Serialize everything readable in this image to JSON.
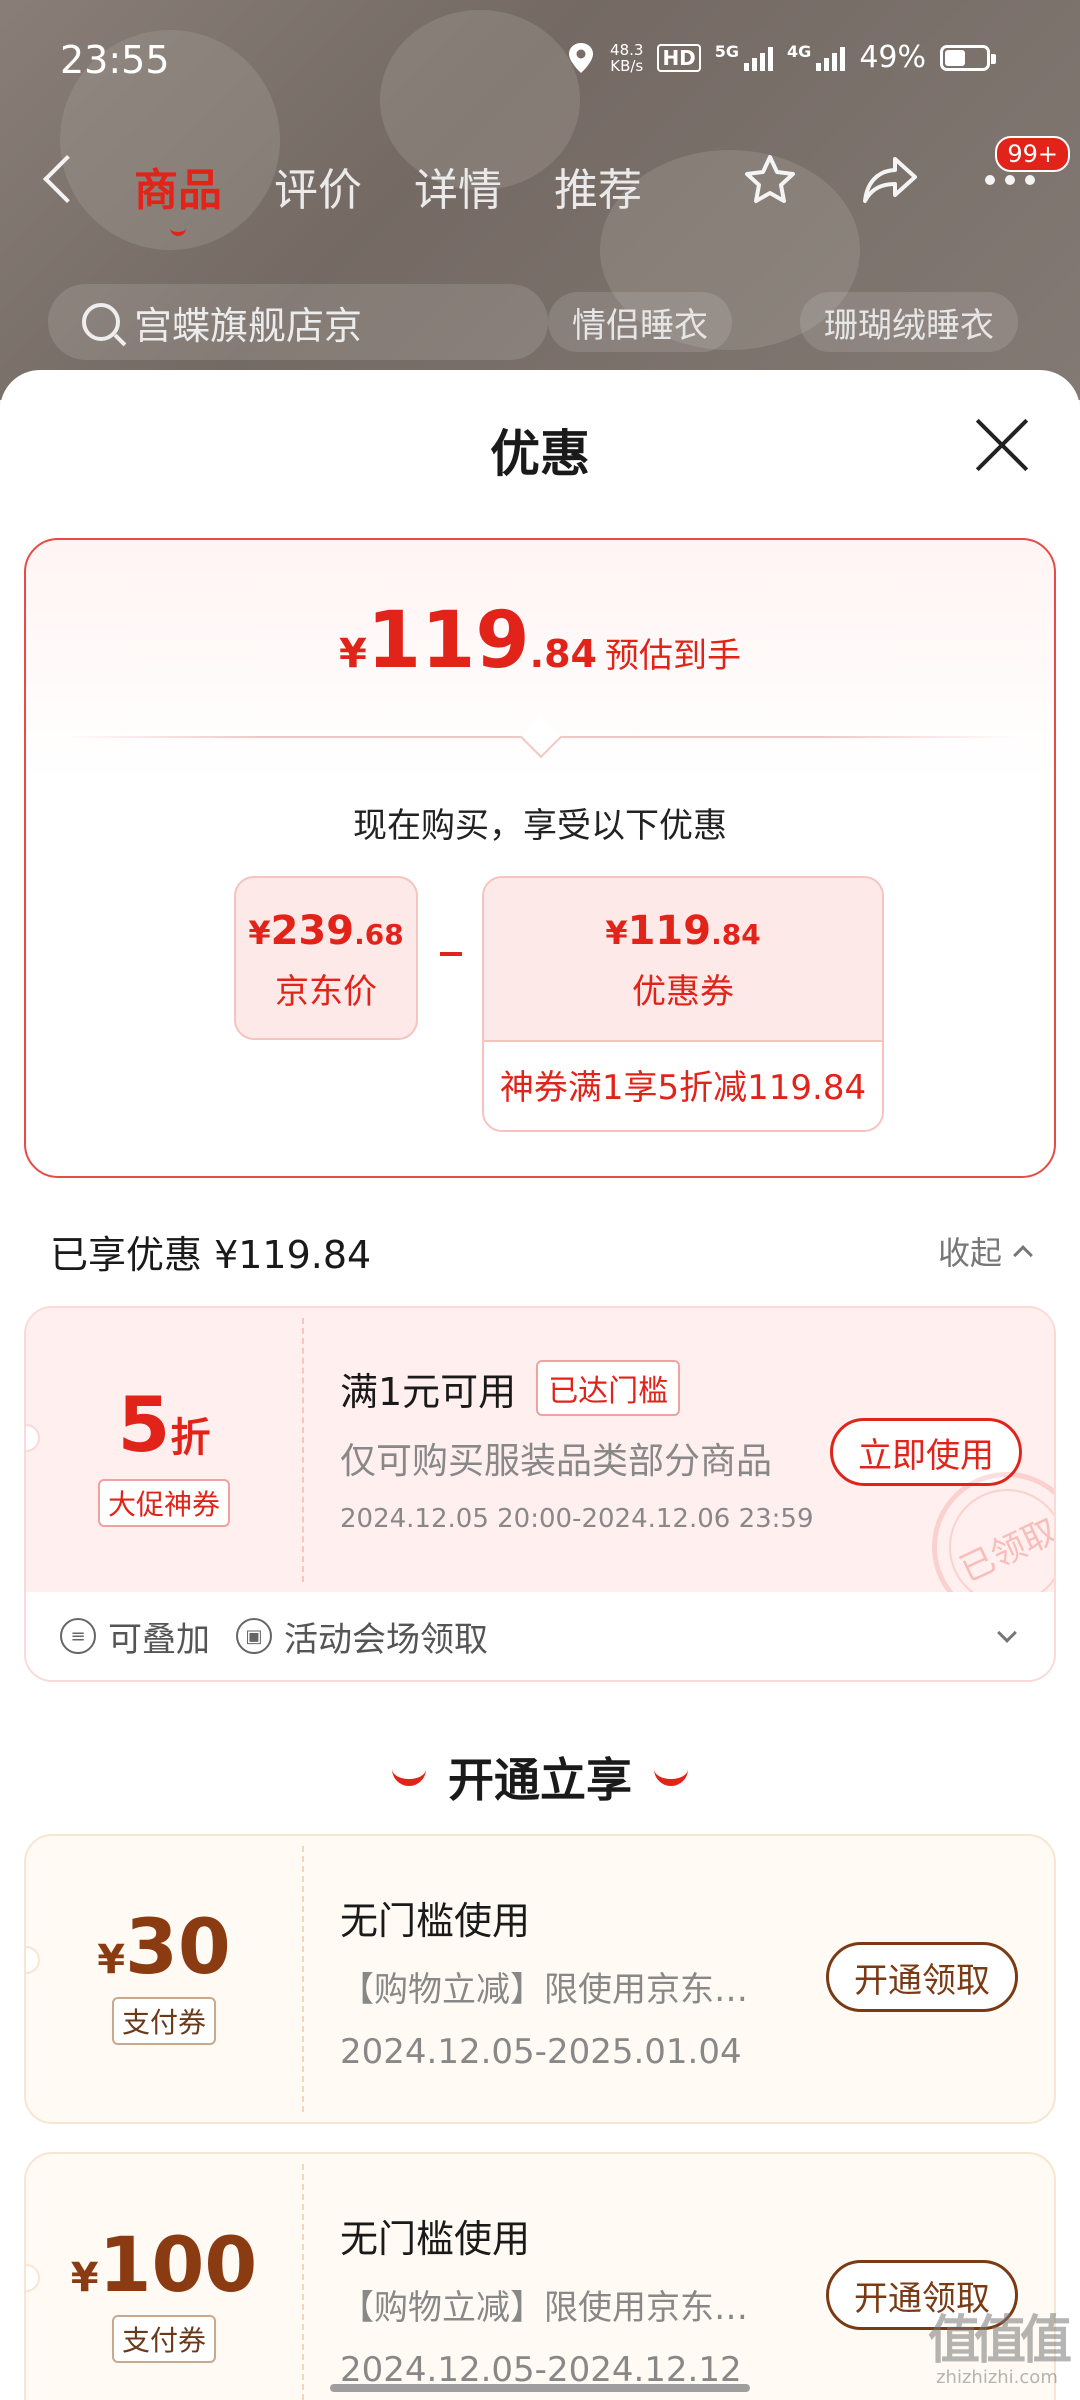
{
  "status": {
    "time": "23:55",
    "net_speed_value": "48.3",
    "net_speed_unit": "KB/s",
    "hd_label": "HD",
    "sim1_label": "5G",
    "sim2_label": "4G",
    "battery": "49%"
  },
  "nav": {
    "tabs": [
      "商品",
      "评价",
      "详情",
      "推荐"
    ],
    "badge": "99+"
  },
  "search": {
    "text": "宫蝶旗舰店京",
    "chips": [
      "情侣睡衣",
      "珊瑚绒睡衣"
    ]
  },
  "sheet": {
    "title": "优惠",
    "estimate": {
      "yen": "¥",
      "int": "119",
      "dec": ".84",
      "label": "预估到手"
    },
    "now_buy": "现在购买，享受以下优惠",
    "jd_price": {
      "yen": "¥",
      "int": "239",
      "dec": ".68",
      "label": "京东价"
    },
    "coupon_price": {
      "yen": "¥",
      "int": "119",
      "dec": ".84",
      "label": "优惠券",
      "sub": "神券满1享5折减119.84"
    },
    "enjoyed": "已享优惠 ¥119.84",
    "collapse": "收起"
  },
  "red_coupon": {
    "discount_num": "5",
    "discount_unit": "折",
    "tag": "大促神券",
    "title": "满1元可用",
    "reached": "已达门槛",
    "desc": "仅可购买服装品类部分商品",
    "date": "2024.12.05 20:00-2024.12.06 23:59",
    "button": "立即使用",
    "stamp": "已领取",
    "foot": [
      "可叠加",
      "活动会场领取"
    ]
  },
  "section_title": "开通立享",
  "gold_coupons": [
    {
      "yen": "¥",
      "amount": "30",
      "tag": "支付券",
      "title": "无门槛使用",
      "desc": "【购物立减】限使用京东…",
      "date": "2024.12.05-2025.01.04",
      "button": "开通领取"
    },
    {
      "yen": "¥",
      "amount": "100",
      "tag": "支付券",
      "title": "无门槛使用",
      "desc": "【购物立减】限使用京东…",
      "date": "2024.12.05-2024.12.12",
      "button": "开通领取"
    }
  ],
  "watermark": {
    "logo": "值值值",
    "url": "zhizhizhi.com"
  },
  "colors": {
    "accent": "#e2231a",
    "gold": "#7a3a14",
    "coupon_bg": "#fff0ef"
  }
}
